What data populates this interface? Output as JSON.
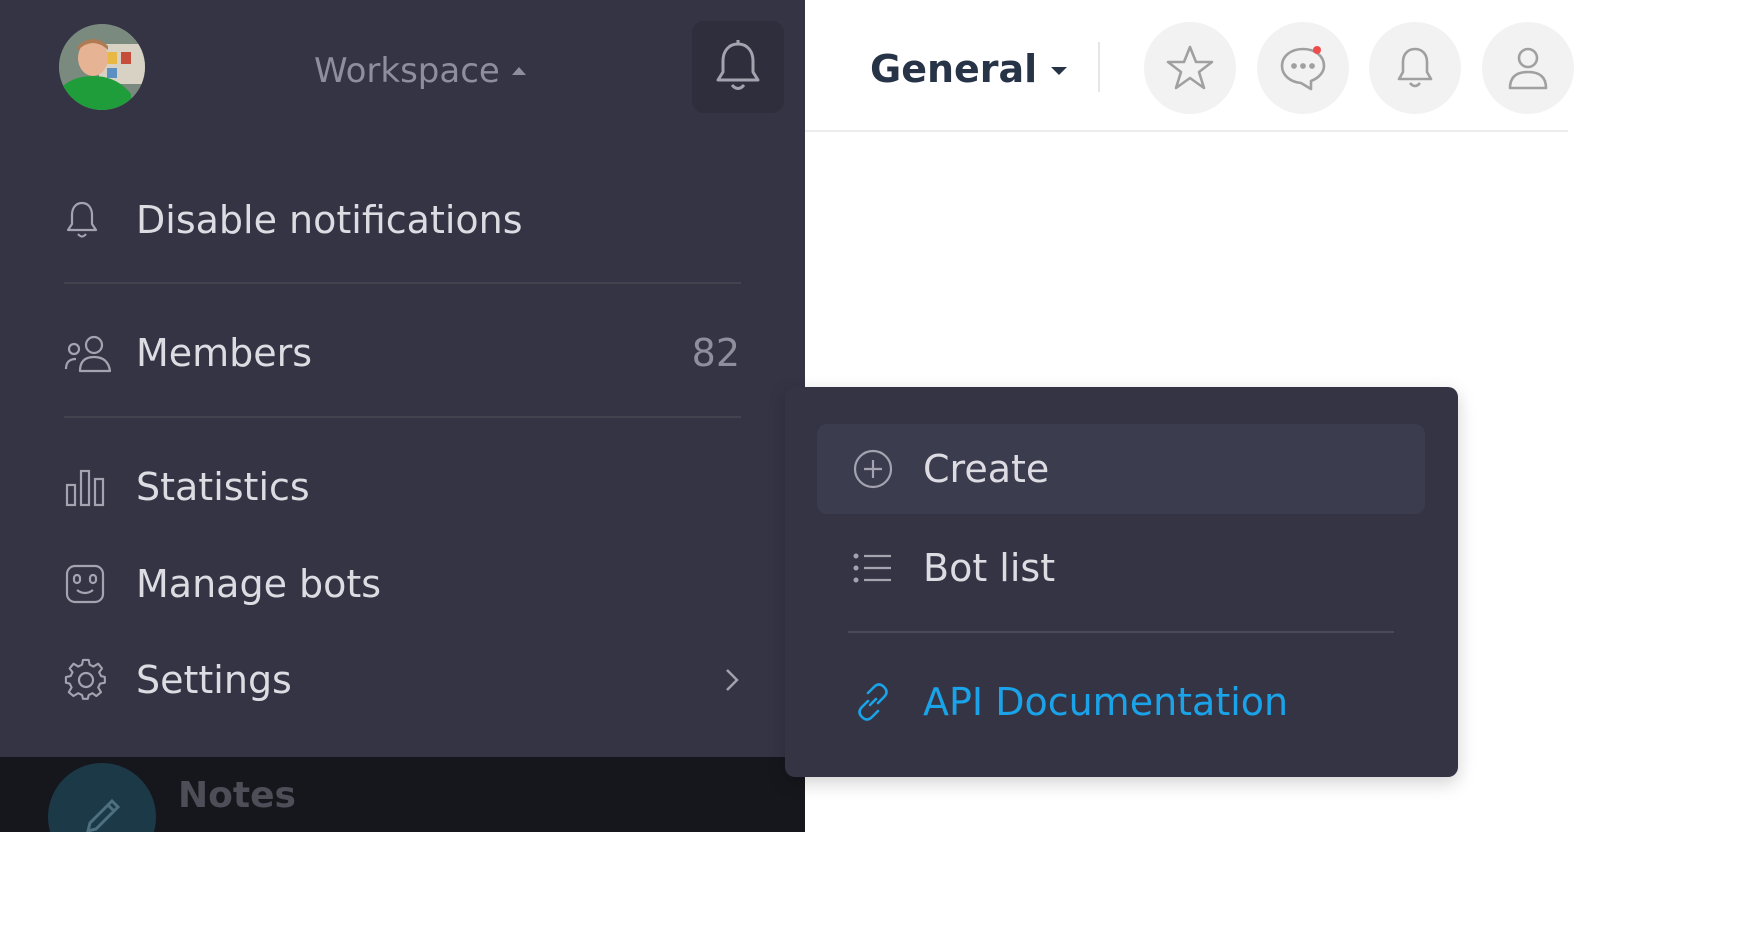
{
  "sidebar": {
    "workspace_label": "Workspace",
    "items": [
      {
        "label": "Disable notifications",
        "icon": "bell-icon"
      },
      {
        "label": "Members",
        "count": "82",
        "icon": "members-icon"
      },
      {
        "label": "Statistics",
        "icon": "bar-chart-icon"
      },
      {
        "label": "Manage bots",
        "icon": "bot-icon"
      },
      {
        "label": "Settings",
        "icon": "gear-icon"
      }
    ],
    "footer_title": "Notes"
  },
  "header": {
    "channel_name": "General",
    "buttons": [
      "star-icon",
      "chat-icon",
      "bell-icon",
      "user-icon"
    ],
    "notification_dot_color": "#f04b4b"
  },
  "bot_menu": {
    "items": [
      {
        "label": "Create",
        "icon": "plus-circle-icon"
      },
      {
        "label": "Bot list",
        "icon": "list-icon"
      },
      {
        "label": "API Documentation",
        "icon": "link-icon"
      }
    ]
  },
  "colors": {
    "sidebar_bg": "#343445",
    "accent_link": "#1aa3e8",
    "title_text": "#273447"
  }
}
